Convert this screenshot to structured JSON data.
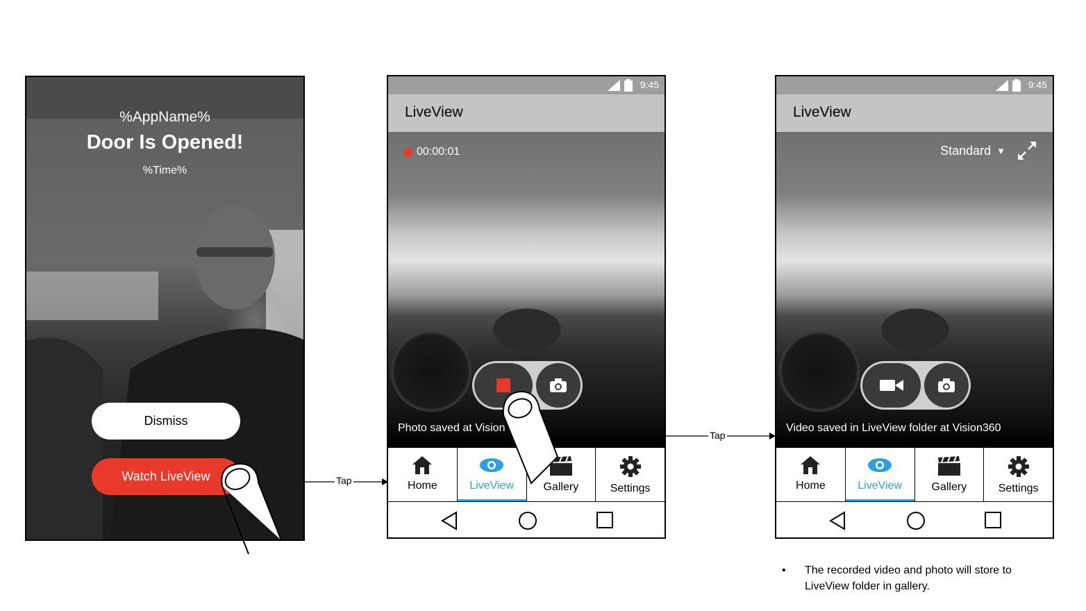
{
  "screen1": {
    "app_name": "%AppName%",
    "alert_title": "Door Is Opened!",
    "time": "%Time%",
    "dismiss_label": "Dismiss",
    "watch_label": "Watch LiveView"
  },
  "screen2": {
    "status": {
      "time": "9:45"
    },
    "title": "LiveView",
    "recording_time": "00:00:01",
    "toast": "Photo saved at Vision",
    "tabs": [
      {
        "label": "Home",
        "icon": "home-icon"
      },
      {
        "label": "LiveView",
        "icon": "eye-icon",
        "active": true
      },
      {
        "label": "Gallery",
        "icon": "clapperboard-icon"
      },
      {
        "label": "Settings",
        "icon": "gear-icon"
      }
    ]
  },
  "screen3": {
    "status": {
      "time": "9:45"
    },
    "title": "LiveView",
    "quality": "Standard",
    "toast": "Video saved in LiveView folder at Vision360",
    "tabs": [
      {
        "label": "Home",
        "icon": "home-icon"
      },
      {
        "label": "LiveView",
        "icon": "eye-icon",
        "active": true
      },
      {
        "label": "Gallery",
        "icon": "clapperboard-icon"
      },
      {
        "label": "Settings",
        "icon": "gear-icon"
      }
    ]
  },
  "arrows": [
    {
      "label": "Tap"
    },
    {
      "label": "Tap"
    }
  ],
  "note": "The recorded video and photo will store to LiveView folder in gallery.",
  "colors": {
    "accent_red": "#e8392a",
    "active_tab_blue": "#2f9fe0",
    "status_bar": "#9e9e9e",
    "app_bar": "#c4c4c4"
  }
}
